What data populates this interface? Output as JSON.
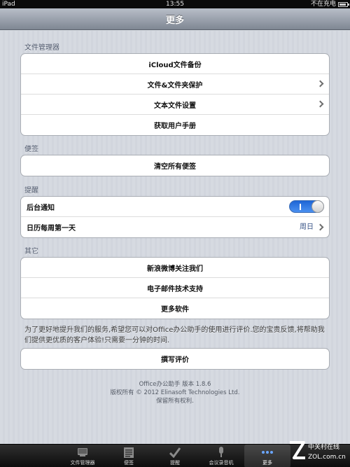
{
  "status_bar": {
    "device": "iPad",
    "time": "13:55",
    "charging": "不在充电"
  },
  "nav": {
    "title": "更多"
  },
  "sections": {
    "file_manager": {
      "header": "文件管理器",
      "items": [
        {
          "label": "iCloud文件备份"
        },
        {
          "label": "文件&文件夹保护"
        },
        {
          "label": "文本文件设置"
        },
        {
          "label": "获取用户手册"
        }
      ]
    },
    "notes": {
      "header": "便签",
      "items": [
        {
          "label": "清空所有便签"
        }
      ]
    },
    "reminder": {
      "header": "提醒",
      "background_label": "后台通知",
      "background_toggle": "on",
      "week_start_label": "日历每周第一天",
      "week_start_value": "周日"
    },
    "other": {
      "header": "其它",
      "items": [
        {
          "label": "新浪微博关注我们"
        },
        {
          "label": "电子邮件技术支持"
        },
        {
          "label": "更多软件"
        }
      ]
    }
  },
  "review": {
    "note": "为了更好地提升我们的服务,希望您可以对Office办公助手的使用进行评价.您的宝贵反馈,将帮助我们提供更优质的客户体验!只需要一分钟的时间.",
    "button": "撰写评价"
  },
  "footer": {
    "line1": "Office办公助手 版本 1.8.6",
    "line2": "版权所有 © 2012 Elinasoft Technologies Ltd.",
    "line3": "保留所有权利."
  },
  "tabs": [
    {
      "label": "文件管理器",
      "icon": "folder-icon"
    },
    {
      "label": "便签",
      "icon": "notes-icon"
    },
    {
      "label": "提醒",
      "icon": "checkmark-icon"
    },
    {
      "label": "会议录音机",
      "icon": "microphone-icon"
    },
    {
      "label": "更多",
      "icon": "more-icon"
    }
  ],
  "watermark": {
    "brand": "中关村在线",
    "site": "ZOL.com.cn"
  },
  "colors": {
    "toggle_on": "#2f7be6",
    "value_text": "#385487",
    "nav_bar": "#9aa1ab"
  }
}
